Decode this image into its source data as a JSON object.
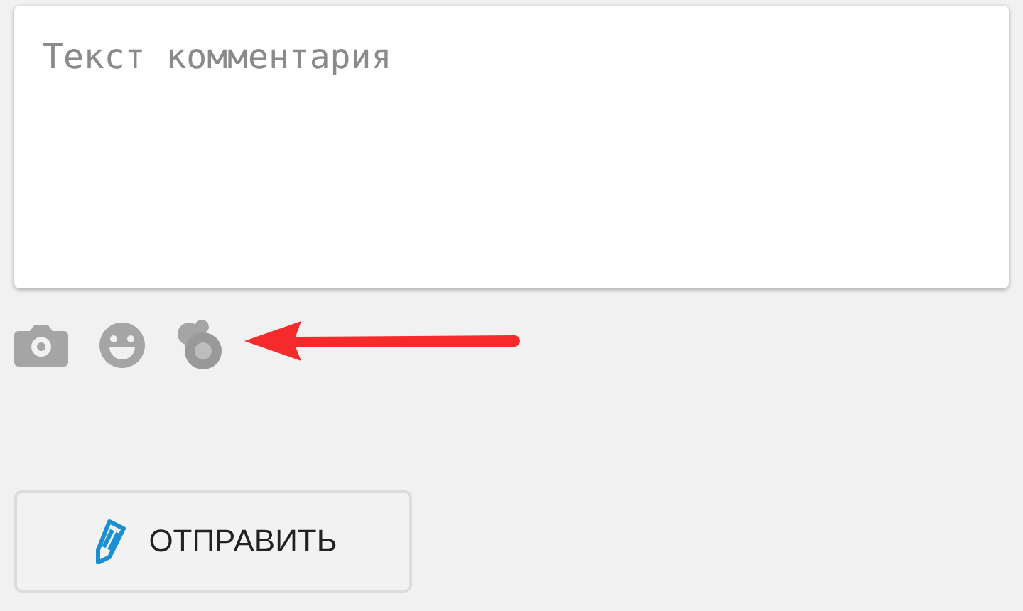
{
  "comment_field": {
    "placeholder": "Текст комментария"
  },
  "attach_tools": [
    {
      "kind": "camera"
    },
    {
      "kind": "emoji"
    },
    {
      "kind": "balls"
    }
  ],
  "submit_button": {
    "label": "ОТПРАВИТЬ"
  }
}
